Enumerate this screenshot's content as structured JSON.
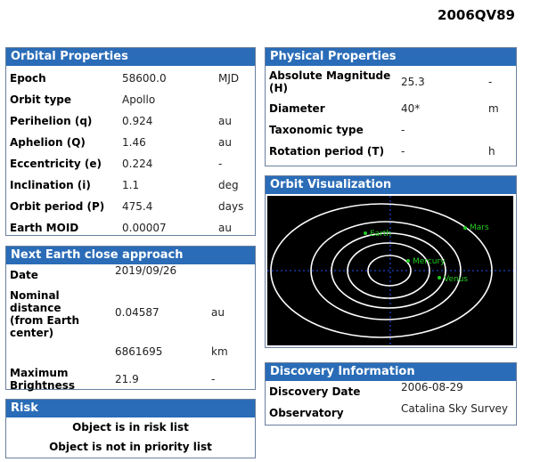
{
  "object_name": "2006QV89",
  "orbital": {
    "header": "Orbital Properties",
    "rows": [
      {
        "label": "Epoch",
        "value": "58600.0",
        "unit": "MJD"
      },
      {
        "label": "Orbit type",
        "value": "Apollo",
        "unit": ""
      },
      {
        "label": "Perihelion (q)",
        "value": "0.924",
        "unit": "au"
      },
      {
        "label": "Aphelion (Q)",
        "value": "1.46",
        "unit": "au"
      },
      {
        "label": "Eccentricity (e)",
        "value": "0.224",
        "unit": "-"
      },
      {
        "label": "Inclination (i)",
        "value": "1.1",
        "unit": "deg"
      },
      {
        "label": "Orbit period (P)",
        "value": "475.4",
        "unit": "days"
      },
      {
        "label": "Earth MOID",
        "value": "0.00007",
        "unit": "au"
      }
    ]
  },
  "approach": {
    "header": "Next Earth close approach",
    "date_label": "Date",
    "date_value": "2019/09/26",
    "nominal_label_1": "Nominal distance",
    "nominal_label_2": "(from Earth",
    "nominal_label_3": "center)",
    "nominal_value": "0.04587",
    "nominal_unit": "au",
    "km_value": "6861695",
    "km_unit": "km",
    "brightness_label_1": "Maximum",
    "brightness_label_2": "Brightness",
    "brightness_value": "21.9",
    "brightness_unit": "-"
  },
  "risk": {
    "header": "Risk",
    "line1": "Object is in risk list",
    "line2": "Object is not in priority list"
  },
  "physical": {
    "header": "Physical Properties",
    "abs_mag_label_1": "Absolute Magnitude",
    "abs_mag_label_2": "(H)",
    "abs_mag_value": "25.3",
    "abs_mag_unit": "-",
    "diameter_label": "Diameter",
    "diameter_value": "40*",
    "diameter_unit": "m",
    "tax_label": "Taxonomic type",
    "tax_value": "-",
    "tax_unit": "",
    "rot_label": "Rotation period (T)",
    "rot_value": "-",
    "rot_unit": "h"
  },
  "visualization": {
    "header": "Orbit Visualization",
    "labels": {
      "earth": "Earth",
      "mars": "Mars",
      "mercury": "Mercury",
      "venus": "Venus"
    },
    "planet_color": "#22cc22",
    "axis_color": "#2255ff",
    "orbit_color": "#ffffff"
  },
  "discovery": {
    "header": "Discovery Information",
    "date_label": "Discovery Date",
    "date_value": "2006-08-29",
    "obs_label": "Observatory",
    "obs_value": "Catalina Sky Survey"
  },
  "colors": {
    "header_bg": "#2a6cb7",
    "border": "#6a7f9e"
  }
}
